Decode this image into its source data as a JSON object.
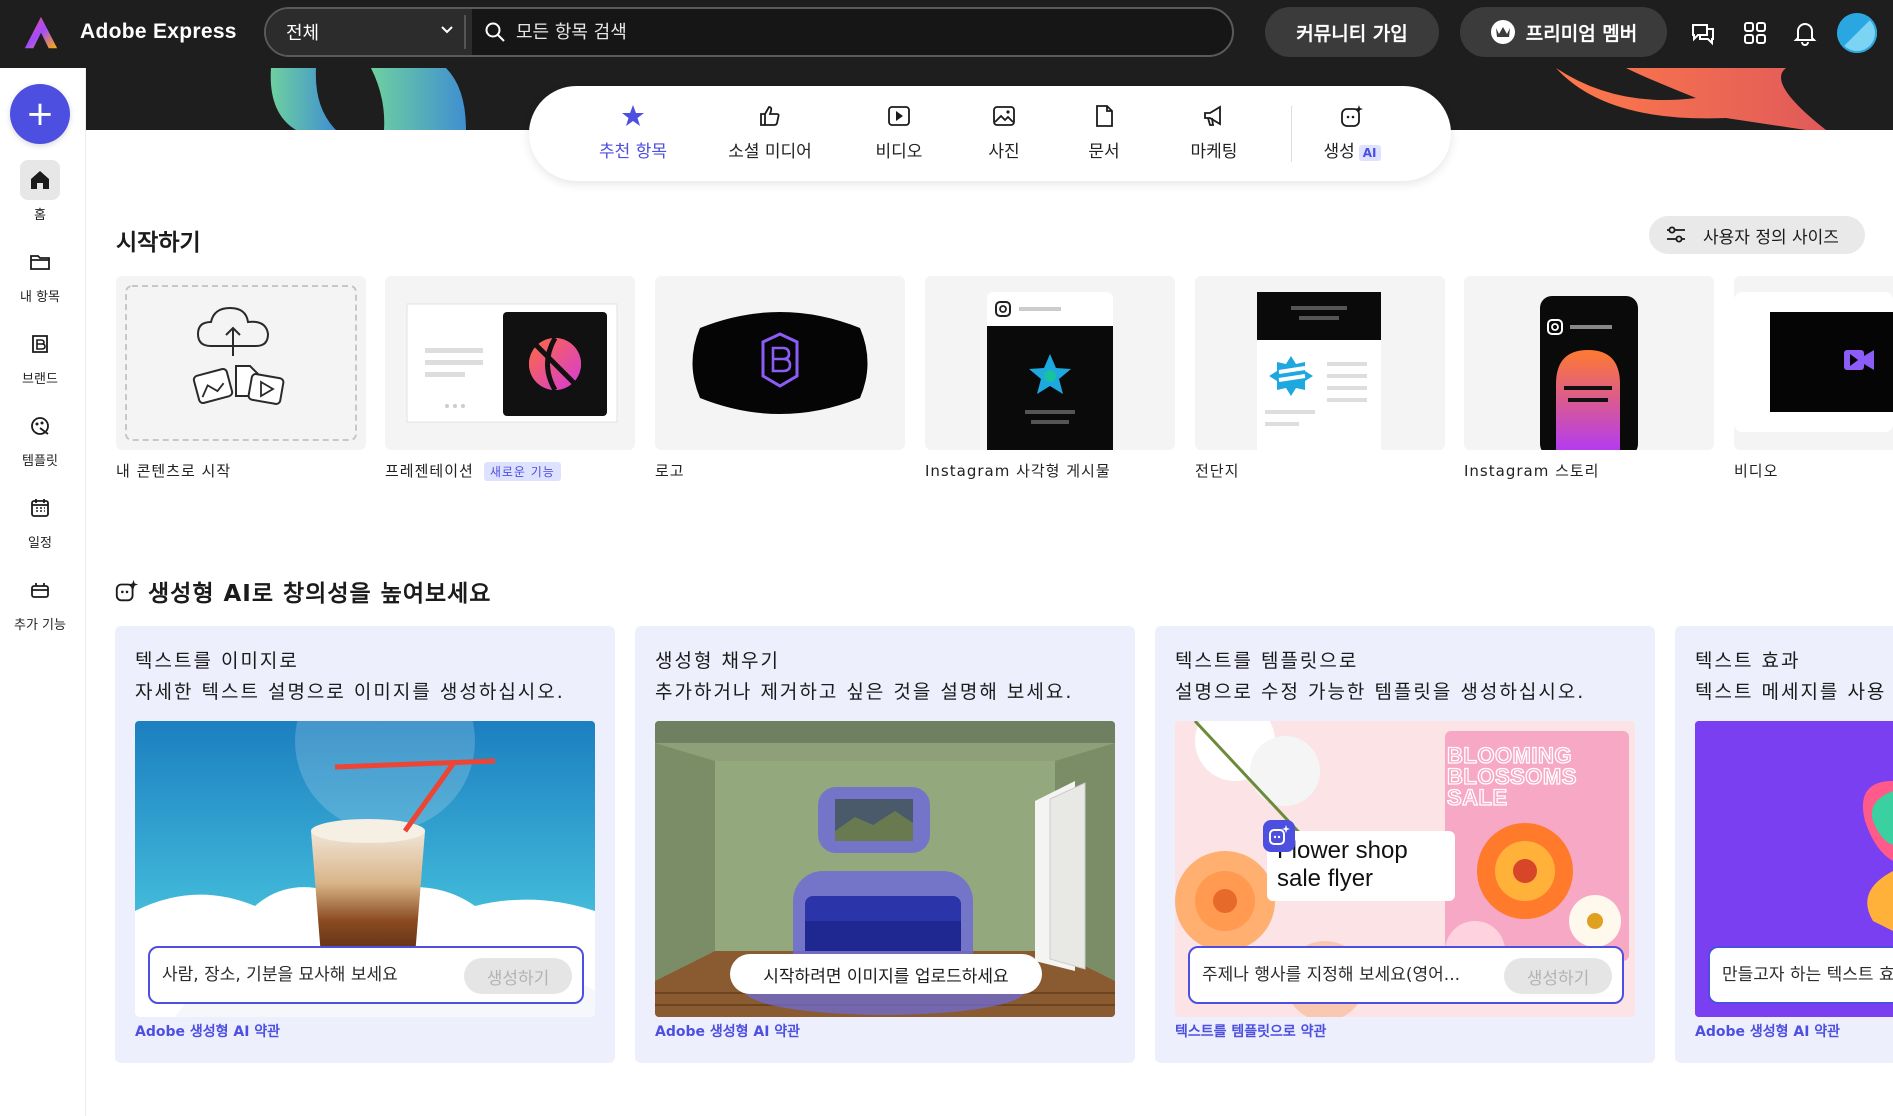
{
  "header": {
    "brand": "Adobe Express",
    "scope": "전체",
    "search_placeholder": "모든 항목 검색",
    "community_label": "커뮤니티 가입",
    "premium_label": "프리미엄 멤버"
  },
  "sidebar": {
    "create_label": "+",
    "items": [
      {
        "label": "홈",
        "icon": "home-icon"
      },
      {
        "label": "내 항목",
        "icon": "folder-icon"
      },
      {
        "label": "브랜드",
        "icon": "brand-icon"
      },
      {
        "label": "템플릿",
        "icon": "template-icon"
      },
      {
        "label": "일정",
        "icon": "calendar-icon"
      },
      {
        "label": "추가 기능",
        "icon": "addon-icon"
      }
    ]
  },
  "tabs": [
    {
      "label": "추천 항목",
      "icon": "star-icon"
    },
    {
      "label": "소셜 미디어",
      "icon": "thumbs-up-icon"
    },
    {
      "label": "비디오",
      "icon": "play-icon"
    },
    {
      "label": "사진",
      "icon": "image-icon"
    },
    {
      "label": "문서",
      "icon": "document-icon"
    },
    {
      "label": "마케팅",
      "icon": "megaphone-icon"
    },
    {
      "label": "생성",
      "icon": "sparkle-image-icon",
      "badge": "AI"
    }
  ],
  "start": {
    "title": "시작하기",
    "custom_size": "사용자 정의 사이즈",
    "cards": [
      {
        "label": "내 콘텐츠로 시작"
      },
      {
        "label": "프레젠테이션",
        "badge": "새로운 기능"
      },
      {
        "label": "로고"
      },
      {
        "label": "Instagram 사각형 게시물"
      },
      {
        "label": "전단지"
      },
      {
        "label": "Instagram 스토리"
      },
      {
        "label": "비디오"
      }
    ]
  },
  "ai": {
    "title": "생성형 AI로 창의성을 높여보세요",
    "cards": [
      {
        "title": "텍스트를 이미지로",
        "desc": "자세한 텍스트 설명으로 이미지를 생성하십시오.",
        "placeholder": "사람, 장소, 기분을 묘사해 보세요",
        "button": "생성하기",
        "footer": "Adobe 생성형 AI 약관"
      },
      {
        "title": "생성형 채우기",
        "desc": "추가하거나 제거하고 싶은 것을 설명해 보세요.",
        "upload": "시작하려면 이미지를 업로드하세요",
        "footer": "Adobe 생성형 AI 약관"
      },
      {
        "title": "텍스트를 템플릿으로",
        "desc": "설명으로 수정 가능한 템플릿을 생성하십시오.",
        "placeholder": "주제나 행사를 지정해 보세요(영어...",
        "button": "생성하기",
        "footer": "텍스트를 템플릿으로 약관",
        "flyer_text": "Flower shop sale flyer",
        "flyer_line1": "Flower shop",
        "flyer_line2": "sale flyer",
        "poster_line1": "BLOOMING",
        "poster_line2": "BLOSSOMS",
        "poster_line3": "SALE"
      },
      {
        "title": "텍스트 효과",
        "desc": "텍스트 메세지를 사용",
        "placeholder": "만들고자 하는 텍스트 효",
        "footer": "Adobe 생성형 AI 약관"
      }
    ]
  },
  "colors": {
    "accent": "#4c4fe0",
    "topbar": "#1e1e1e"
  }
}
